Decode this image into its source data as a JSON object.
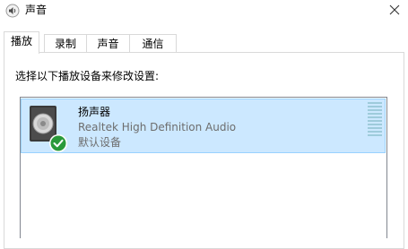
{
  "window": {
    "title": "声音",
    "app_icon": "speaker-app-icon",
    "close_icon": "close-icon"
  },
  "tabs": [
    {
      "label": "播放",
      "active": true
    },
    {
      "label": "录制",
      "active": false
    },
    {
      "label": "声音",
      "active": false
    },
    {
      "label": "通信",
      "active": false
    }
  ],
  "playback": {
    "prompt": "选择以下播放设备来修改设置:",
    "devices": [
      {
        "name": "扬声器",
        "driver": "Realtek High Definition Audio",
        "status": "默认设备",
        "icon": "speaker-icon",
        "default_badge": "check-icon",
        "selected": true
      }
    ]
  },
  "colors": {
    "selection_bg": "#cce8ff",
    "selection_border": "#99d1ff",
    "default_badge": "#2a9a3a",
    "secondary_text": "#6d6d6d"
  }
}
